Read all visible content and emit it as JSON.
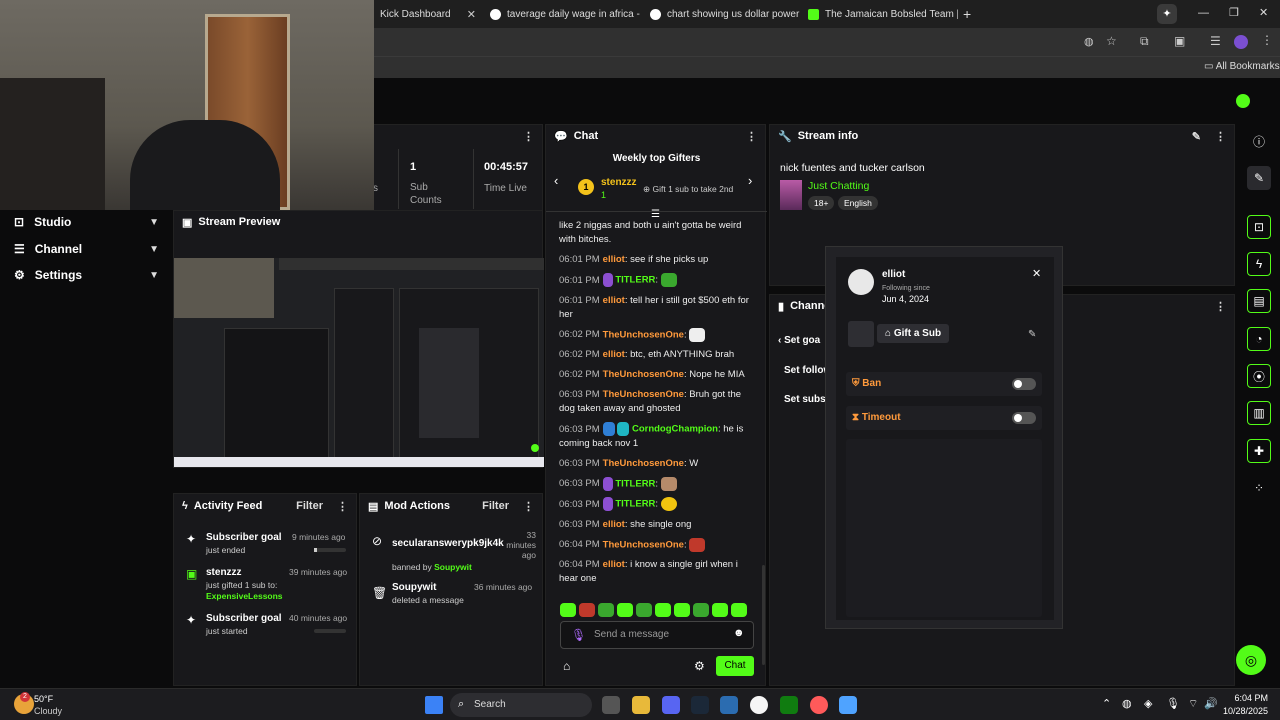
{
  "browser": {
    "tabs": [
      {
        "label": "Kick Dashboard"
      },
      {
        "label": "taverage daily wage in africa - "
      },
      {
        "label": "chart showing us dollar power "
      },
      {
        "label": "The Jamaican Bobsled Team | T"
      }
    ],
    "all_bookmarks": "All Bookmarks"
  },
  "sidebar": {
    "items": [
      {
        "label": "Studio"
      },
      {
        "label": "Channel"
      },
      {
        "label": "Settings"
      }
    ]
  },
  "stats": {
    "subs_value": "1",
    "subs_label": "Sub Counts",
    "time_value": "00:45:57",
    "time_label": "Time Live",
    "cut_label": "s"
  },
  "preview": {
    "title": "Stream Preview"
  },
  "activity": {
    "title": "Activity Feed",
    "filter": "Filter",
    "items": [
      {
        "name": "Subscriber goal",
        "sub": "just ended",
        "time": "9 minutes ago"
      },
      {
        "name": "stenzzz",
        "sub": "just gifted 1 sub to:",
        "target": "ExpensiveLessons",
        "time": "39 minutes ago"
      },
      {
        "name": "Subscriber goal",
        "sub": "just started",
        "time": "40 minutes ago"
      }
    ]
  },
  "mod": {
    "title": "Mod Actions",
    "filter": "Filter",
    "items": [
      {
        "name": "secularanswerypk9jk4k",
        "sub_prefix": "banned by ",
        "sub_user": "Soupywit",
        "time": "33 minutes ago"
      },
      {
        "name": "Soupywit",
        "sub_prefix": "deleted a message",
        "sub_user": "",
        "time": "36 minutes ago"
      }
    ]
  },
  "chat": {
    "title": "Chat",
    "gifters_title": "Weekly top Gifters",
    "gifter_name": "stenzzz",
    "gifter_count": "1",
    "gifter_rank": "1",
    "gift_cta": "Gift 1 sub to take 2nd",
    "overflow": "like 2 niggas and both u ain't gotta be weird with bitches.",
    "messages": [
      {
        "time": "06:01 PM",
        "user": "elliot",
        "color": "#ff9a3c",
        "text": "see if she picks up"
      },
      {
        "time": "06:01 PM",
        "user": "TITLERR",
        "color": "#53fc18",
        "text": ""
      },
      {
        "time": "06:01 PM",
        "user": "elliot",
        "color": "#ff9a3c",
        "text": "tell her i still got $500 eth for her"
      },
      {
        "time": "06:02 PM",
        "user": "TheUnchosenOne",
        "color": "#ff9a3c",
        "text": ""
      },
      {
        "time": "06:02 PM",
        "user": "elliot",
        "color": "#ff9a3c",
        "text": "btc, eth ANYTHING brah"
      },
      {
        "time": "06:02 PM",
        "user": "TheUnchosenOne",
        "color": "#ff9a3c",
        "text": "Nope he MIA"
      },
      {
        "time": "06:03 PM",
        "user": "TheUnchosenOne",
        "color": "#ff9a3c",
        "text": "Bruh got the dog taken away and ghosted"
      },
      {
        "time": "06:03 PM",
        "user": "CorndogChampion",
        "color": "#53fc18",
        "text": "he is coming back nov 1"
      },
      {
        "time": "06:03 PM",
        "user": "TheUnchosenOne",
        "color": "#ff9a3c",
        "text": "W"
      },
      {
        "time": "06:03 PM",
        "user": "TITLERR",
        "color": "#53fc18",
        "text": ""
      },
      {
        "time": "06:03 PM",
        "user": "TITLERR",
        "color": "#53fc18",
        "text": ""
      },
      {
        "time": "06:03 PM",
        "user": "elliot",
        "color": "#ff9a3c",
        "text": "she single ong"
      },
      {
        "time": "06:04 PM",
        "user": "TheUnchosenOne",
        "color": "#ff9a3c",
        "text": ""
      },
      {
        "time": "06:04 PM",
        "user": "elliot",
        "color": "#ff9a3c",
        "text": "i know a single girl when i hear one"
      }
    ],
    "placeholder": "Send a message",
    "send": "Chat"
  },
  "streaminfo": {
    "title": "Stream info",
    "stream_title": "nick fuentes and tucker carlson",
    "category": "Just Chatting",
    "tag1": "18+",
    "tag2": "English"
  },
  "channel": {
    "title": "Channe",
    "goal": "Set goa",
    "follow": "Set follow",
    "subs": "Set subsc"
  },
  "user_card": {
    "name": "elliot",
    "following_label": "Following since",
    "following_date": "Jun 4, 2024",
    "gift": "Gift a Sub",
    "ban": "Ban",
    "timeout": "Timeout",
    "ban_on": false,
    "timeout_on": false
  },
  "taskbar": {
    "temp": "50°F",
    "weather": "Cloudy",
    "search": "Search",
    "time": "6:04 PM",
    "date": "10/28/2025",
    "badge": "2"
  }
}
